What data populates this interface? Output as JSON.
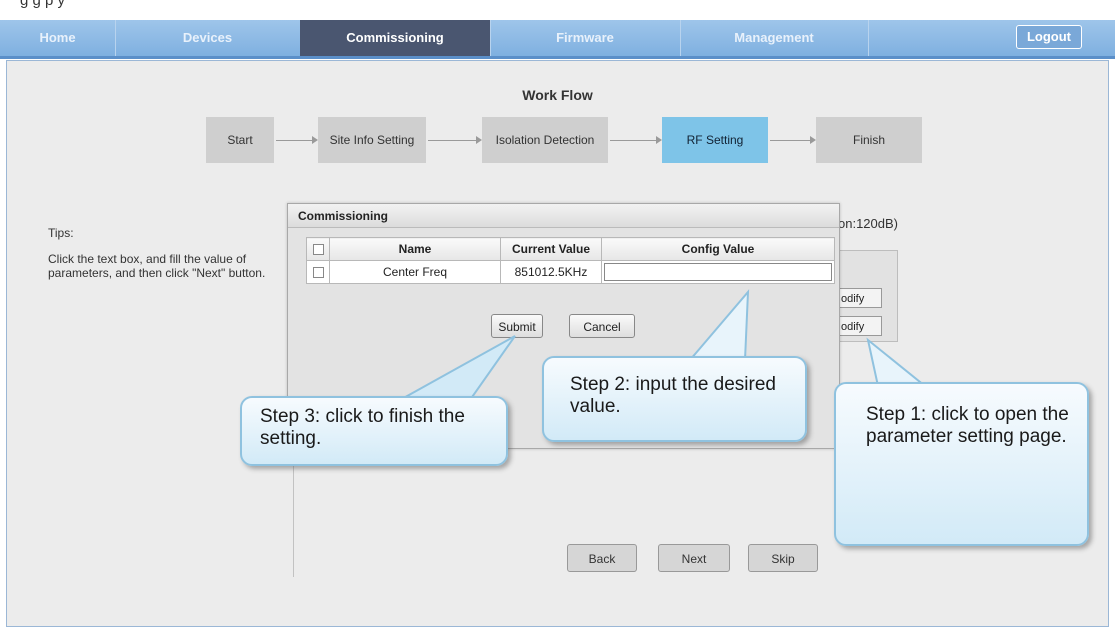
{
  "clipped_header_text": "g              g         p   y",
  "nav": {
    "tabs": [
      {
        "label": "Home",
        "active": false
      },
      {
        "label": "Devices",
        "active": false
      },
      {
        "label": "Commissioning",
        "active": true
      },
      {
        "label": "Firmware",
        "active": false
      },
      {
        "label": "Management",
        "active": false
      }
    ],
    "logout_label": "Logout"
  },
  "workflow": {
    "title": "Work Flow",
    "steps": [
      "Start",
      "Site Info Setting",
      "Isolation Detection",
      "RF Setting",
      "Finish"
    ],
    "current_step": "RF Setting"
  },
  "tips": {
    "title": "Tips:",
    "body": "Click the text box, and fill the value of parameters, and then click \"Next\" button."
  },
  "background": {
    "rf_label_partial": "on:120dB)",
    "modify_label_partial": "odify"
  },
  "dialog": {
    "title": "Commissioning",
    "columns": [
      "Name",
      "Current Value",
      "Config Value"
    ],
    "rows": [
      {
        "name": "Center Freq",
        "current_value": "851012.5KHz",
        "config_value": ""
      }
    ],
    "submit_label": "Submit",
    "cancel_label": "Cancel"
  },
  "nav_buttons": {
    "back": "Back",
    "next": "Next",
    "skip": "Skip"
  },
  "callouts": {
    "step1": "Step 1: click to open the parameter setting page.",
    "step2": "Step 2: input the desired value.",
    "step3": "Step 3: click to finish the setting."
  },
  "colors": {
    "nav_bg": "#8cbbe6",
    "nav_active": "#4a5670",
    "current_step": "#7ec4e8",
    "callout_border": "#8fc2df"
  }
}
